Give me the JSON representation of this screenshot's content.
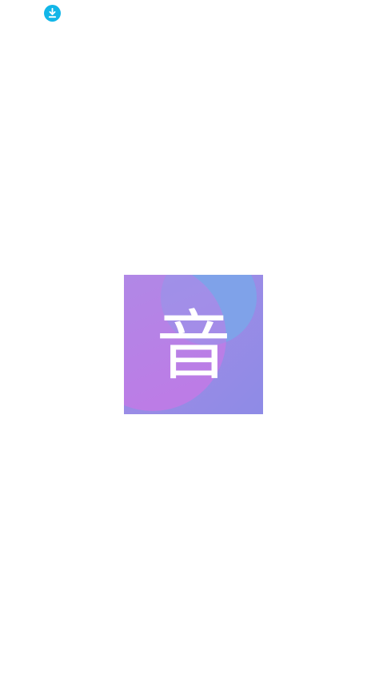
{
  "status_bar": {
    "notification_icon": "download-icon",
    "icon_color": "#12B6E8"
  },
  "splash": {
    "logo_glyph": "音",
    "logo_colors": {
      "base": "#8E8BE6",
      "top_right": "#7FA3E8",
      "left_circle": "#B286E6",
      "bottom_left": "#B97BE6"
    }
  }
}
